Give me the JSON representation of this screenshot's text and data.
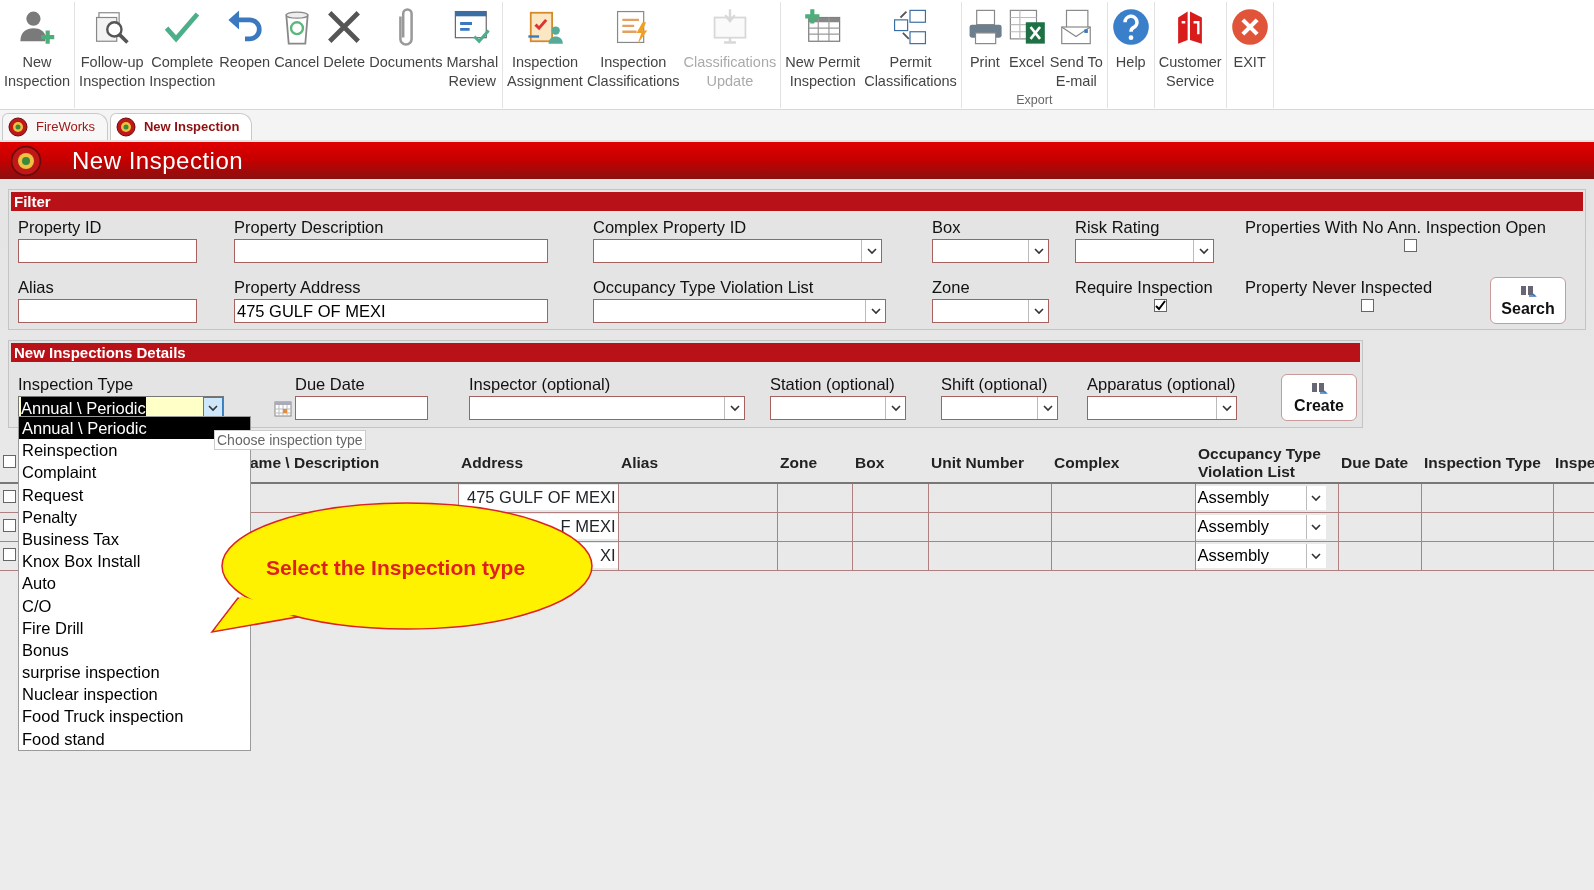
{
  "ribbon": {
    "groups": [
      {
        "buttons": [
          {
            "label": "New\nInspection",
            "disabled": false
          }
        ]
      },
      {
        "buttons": [
          {
            "label": "Follow-up\nInspection",
            "disabled": false
          },
          {
            "label": "Complete\nInspection",
            "disabled": false
          },
          {
            "label": "Reopen",
            "disabled": false
          },
          {
            "label": "Cancel",
            "disabled": false
          },
          {
            "label": "Delete",
            "disabled": false
          },
          {
            "label": "Documents",
            "disabled": false
          },
          {
            "label": "Marshal\nReview",
            "disabled": false
          }
        ]
      },
      {
        "buttons": [
          {
            "label": "Inspection\nAssignment",
            "disabled": false
          },
          {
            "label": "Inspection\nClassifications",
            "disabled": false
          },
          {
            "label": "Classifications\nUpdate",
            "disabled": true
          }
        ]
      },
      {
        "buttons": [
          {
            "label": "New Permit\nInspection",
            "disabled": false
          },
          {
            "label": "Permit\nClassifications",
            "disabled": false
          }
        ]
      },
      {
        "group_label": "Export",
        "buttons": [
          {
            "label": "Print",
            "disabled": false
          },
          {
            "label": "Excel",
            "disabled": false
          },
          {
            "label": "Send To\nE-mail",
            "disabled": false
          }
        ]
      },
      {
        "buttons": [
          {
            "label": "Help",
            "disabled": false
          }
        ]
      },
      {
        "buttons": [
          {
            "label": "Customer\nService",
            "disabled": false
          }
        ]
      },
      {
        "buttons": [
          {
            "label": "EXIT",
            "disabled": false
          }
        ]
      }
    ]
  },
  "tabs": [
    {
      "label": "FireWorks",
      "selected": false
    },
    {
      "label": "New Inspection",
      "selected": true
    }
  ],
  "title": "New Inspection",
  "filter": {
    "title": "Filter",
    "rows": [
      {
        "fields": [
          {
            "kind": "text",
            "label": "Property ID"
          },
          {
            "kind": "text",
            "label": "Property Description"
          },
          {
            "kind": "select",
            "label": "Complex Property ID"
          },
          {
            "kind": "select",
            "label": "Box"
          },
          {
            "kind": "select",
            "label": "Risk Rating"
          },
          {
            "kind": "checkbox",
            "label": "Properties With No Ann. Inspection Open",
            "checked": false
          }
        ]
      },
      {
        "fields": [
          {
            "kind": "text",
            "label": "Alias"
          },
          {
            "kind": "text",
            "label": "Property Address",
            "value": "475 GULF OF MEXI"
          },
          {
            "kind": "select",
            "label": "Occupancy Type Violation List"
          },
          {
            "kind": "select",
            "label": "Zone"
          },
          {
            "kind": "checkbox",
            "label": "Require Inspection",
            "checked": true
          },
          {
            "kind": "checkbox",
            "label": "Property Never Inspected",
            "checked": false
          },
          {
            "kind": "button",
            "label": "Search"
          }
        ]
      }
    ]
  },
  "details": {
    "title": "New Inspections Details",
    "fields": [
      {
        "kind": "select",
        "label": "Inspection Type",
        "value": "Annual \\ Periodic",
        "expanded": true,
        "tooltip": "Choose inspection type",
        "options": [
          {
            "label": "Annual \\ Periodic",
            "selected": true
          },
          {
            "label": "Reinspection",
            "selected": false
          },
          {
            "label": "Complaint",
            "selected": false
          },
          {
            "label": "Request",
            "selected": false
          },
          {
            "label": "Penalty",
            "selected": false
          },
          {
            "label": "Business Tax",
            "selected": false
          },
          {
            "label": "Knox Box Install",
            "selected": false
          },
          {
            "label": "Auto",
            "selected": false
          },
          {
            "label": "C/O",
            "selected": false
          },
          {
            "label": "Fire Drill",
            "selected": false
          },
          {
            "label": "Bonus",
            "selected": false
          },
          {
            "label": "surprise inspection",
            "selected": false
          },
          {
            "label": "Nuclear inspection",
            "selected": false
          },
          {
            "label": "Food Truck inspection",
            "selected": false
          },
          {
            "label": "Food stand",
            "selected": false
          }
        ]
      },
      {
        "kind": "date",
        "label": "Due Date"
      },
      {
        "kind": "select",
        "label": "Inspector (optional)"
      },
      {
        "kind": "select",
        "label": "Station (optional)"
      },
      {
        "kind": "select",
        "label": "Shift (optional)"
      },
      {
        "kind": "select",
        "label": "Apparatus (optional)"
      },
      {
        "kind": "button",
        "label": "Create"
      }
    ]
  },
  "table": {
    "select_all_checked": false,
    "columns": [
      "ame \\ Description",
      "Address",
      "Alias",
      "Zone",
      "Box",
      "Unit Number",
      "Complex",
      "Occupancy Type\nViolation List",
      "Due Date",
      "Inspection Type",
      "Inspe"
    ],
    "rows": [
      {
        "checked": false,
        "address": "475 GULF OF MEXI",
        "occupancy": "Assembly"
      },
      {
        "checked": false,
        "address": "F MEXI",
        "occupancy": "Assembly"
      },
      {
        "checked": false,
        "address": "XI",
        "occupancy": "Assembly"
      }
    ]
  },
  "callout": {
    "text": "Select the Inspection type"
  }
}
